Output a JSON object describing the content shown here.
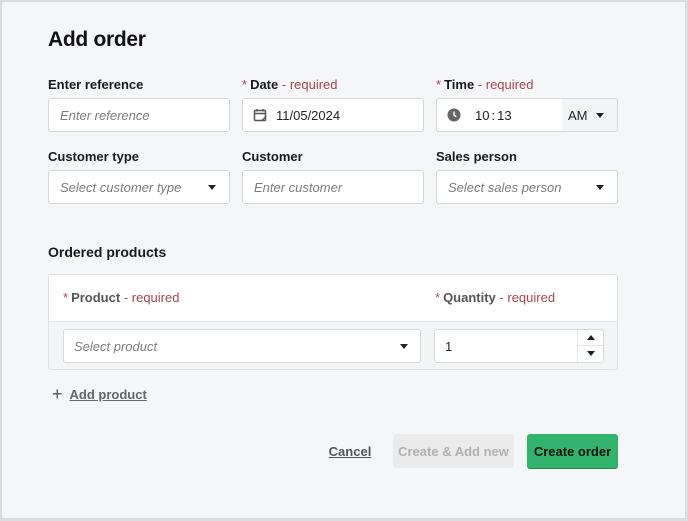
{
  "dialog": {
    "title": "Add order"
  },
  "form": {
    "reference": {
      "label": "Enter reference",
      "placeholder": "Enter reference",
      "value": ""
    },
    "date": {
      "label": "Date",
      "required_text": "- required",
      "required_star": "*",
      "value": "11/05/2024",
      "icon": "calendar-icon"
    },
    "time": {
      "label": "Time",
      "required_text": "- required",
      "required_star": "*",
      "hours": "10",
      "separator": ":",
      "minutes": "13",
      "period": "AM",
      "icon": "clock-icon"
    },
    "customer_type": {
      "label": "Customer type",
      "placeholder": "Select customer type"
    },
    "customer": {
      "label": "Customer",
      "placeholder": "Enter customer"
    },
    "sales_person": {
      "label": "Sales person",
      "placeholder": "Select sales person"
    }
  },
  "ordered_products": {
    "title": "Ordered products",
    "columns": [
      {
        "label": "Product",
        "required_star": "*",
        "required_text": "- required"
      },
      {
        "label": "Quantity",
        "required_star": "*",
        "required_text": "- required"
      }
    ],
    "rows": [
      {
        "product_placeholder": "Select product",
        "quantity": "1"
      }
    ],
    "add_label": "Add product",
    "add_icon": "+"
  },
  "actions": {
    "cancel": "Cancel",
    "create_add_new": "Create & Add new",
    "create": "Create order"
  },
  "colors": {
    "primary": "#33b46d",
    "required": "#a84452",
    "disabled_bg": "#ebebeb"
  }
}
